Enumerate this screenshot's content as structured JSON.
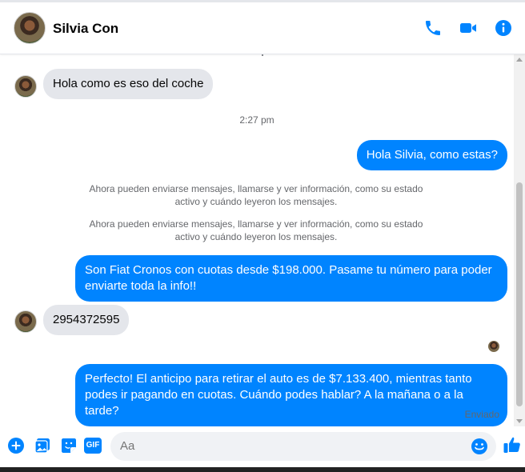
{
  "header": {
    "contact_name": "Silvia Con",
    "actions": [
      "phone-icon",
      "video-icon",
      "info-icon"
    ]
  },
  "conversation": {
    "messages": [
      {
        "from": "contact",
        "text": "Hola como es eso del coche"
      },
      {
        "type": "timestamp",
        "text": "2:27 pm"
      },
      {
        "from": "me",
        "text": "Hola Silvia, como estas?"
      },
      {
        "type": "system",
        "text": "Ahora pueden enviarse mensajes, llamarse y ver información, como su estado activo y cuándo leyeron los mensajes."
      },
      {
        "type": "system",
        "text": "Ahora pueden enviarse mensajes, llamarse y ver información, como su estado activo y cuándo leyeron los mensajes."
      },
      {
        "from": "me",
        "text": "Son Fiat Cronos con cuotas desde $198.000. Pasame tu número para poder enviarte toda la info!!"
      },
      {
        "from": "contact",
        "text": "2954372595"
      },
      {
        "from": "me",
        "text": "Perfecto! El anticipo para retirar el auto es de $7.133.400, mientras tanto podes ir pagando en cuotas. Cuándo podes hablar? A la mañana o a la tarde?"
      }
    ],
    "status": "Enviado"
  },
  "composer": {
    "placeholder": "Aa",
    "icons": [
      "plus-icon",
      "photo-icon",
      "sticker-icon",
      "gif-icon",
      "emoji-icon",
      "like-icon"
    ],
    "gif_label": "GIF"
  },
  "colors": {
    "accent": "#0084ff",
    "incoming_bubble": "#e4e6eb",
    "muted_text": "#65676b"
  }
}
